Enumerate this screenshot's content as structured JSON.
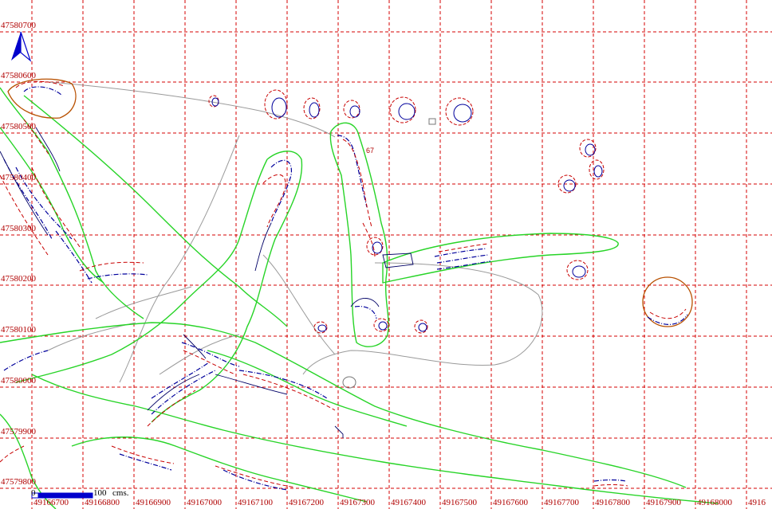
{
  "map": {
    "y_axis_labels": [
      "47580700",
      "47580600",
      "47580500",
      "47580400",
      "47580300",
      "47580200",
      "47580100",
      "47580000",
      "47579900",
      "47579800"
    ],
    "x_axis_labels": [
      "49166700",
      "49166800",
      "49166900",
      "49167000",
      "49167100",
      "49167200",
      "49167300",
      "49167400",
      "49167500",
      "49167600",
      "49167700",
      "49167800",
      "49167900",
      "49168000",
      "4916"
    ],
    "feature_label": "67",
    "scale": {
      "start": "0",
      "end": "100",
      "unit": "cms."
    },
    "north_arrow": "north-arrow-icon",
    "colors": {
      "grid": "#d40000",
      "contour_outline": "#27d427",
      "pit_outline": "#b85000",
      "depth_lines_blue": "#00009c",
      "depth_lines_red": "#c80000",
      "baseline_gray": "#9a9a9a",
      "scale_bar": "#0000cc",
      "background": "#ffffff"
    }
  }
}
